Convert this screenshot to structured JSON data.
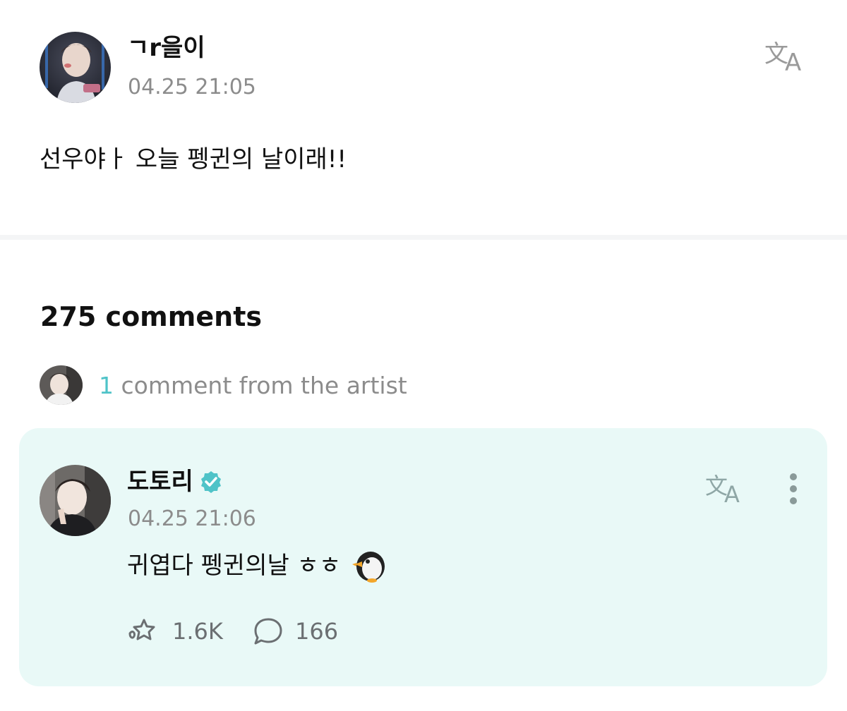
{
  "post": {
    "author": "ㄱr을이",
    "timestamp": "04.25 21:05",
    "body": "선우야ㅏ  오늘 펭귄의 날이래!!",
    "translate_icon": "translate-icon",
    "avatar_icon": "avatar"
  },
  "comments": {
    "count_label": "275 comments",
    "artist_summary": {
      "count": "1",
      "label": "comment from the artist"
    }
  },
  "artist_comment": {
    "author": "도토리",
    "verified": true,
    "timestamp": "04.25 21:06",
    "body": "귀엽다 펭귄의날 ㅎㅎ",
    "emoji": "penguin",
    "likes": "1.6K",
    "replies": "166",
    "icons": [
      "verified-badge-icon",
      "translate-icon",
      "more-vertical-icon",
      "like-icon",
      "reply-icon",
      "penguin-icon"
    ]
  },
  "colors": {
    "accent_teal": "#4fc3c8",
    "card_background": "#e9f9f7",
    "muted_text": "#8c8c8c",
    "divider": "#f4f5f6"
  }
}
